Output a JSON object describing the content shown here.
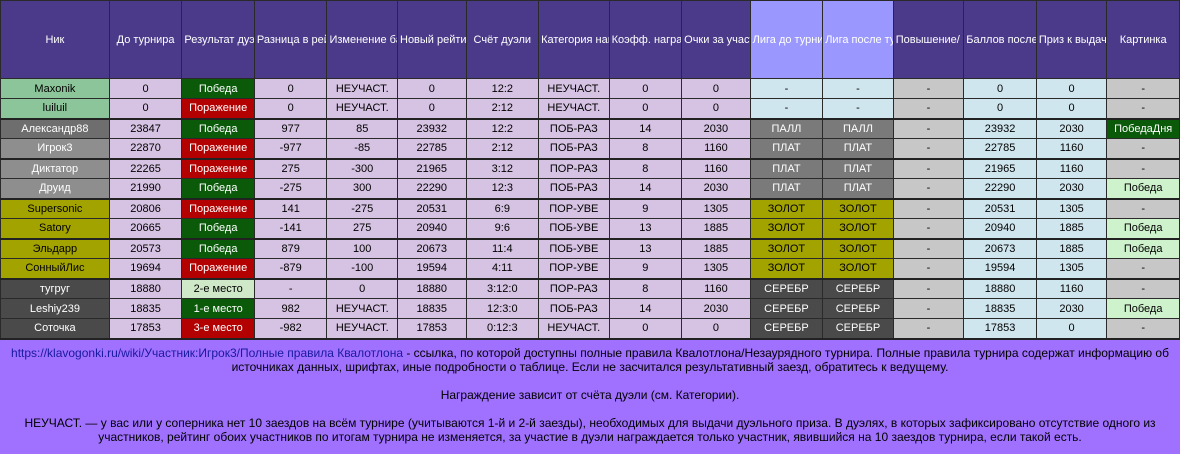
{
  "headers": [
    "Ник",
    "До турнира",
    "Результат дуэли",
    "Разница в рейтинге",
    "Изменение баллов",
    "Новый рейтинг",
    "Счёт дуэли",
    "Категория награждения",
    "Коэфф. награждения",
    "Очки за участие",
    "Лига до турнира",
    "Лига после турнира",
    "Повышение/ понижение",
    "Баллов после турнира",
    "Приз к выдаче, очков",
    "Картинка"
  ],
  "rows": [
    {
      "nick": "Maxonik",
      "nick_class": "nick-novice",
      "before": "0",
      "result": "Победа",
      "res_class": "c-win",
      "diff": "0",
      "change": "НЕУЧАСТ.",
      "new_rating": "0",
      "score": "12:2",
      "category": "НЕУЧАСТ.",
      "coef": "0",
      "points": "0",
      "league_before": "-",
      "league_after": "-",
      "lg_class": "lg-none",
      "promo": "-",
      "after_points": "0",
      "prize": "0",
      "picture": "-",
      "pic_class": "c-grey",
      "group_end": false
    },
    {
      "nick": "luiluil",
      "nick_class": "nick-novice",
      "before": "0",
      "result": "Поражение",
      "res_class": "c-lose",
      "diff": "0",
      "change": "НЕУЧАСТ.",
      "new_rating": "0",
      "score": "2:12",
      "category": "НЕУЧАСТ.",
      "coef": "0",
      "points": "0",
      "league_before": "-",
      "league_after": "-",
      "lg_class": "lg-none",
      "promo": "-",
      "after_points": "0",
      "prize": "0",
      "picture": "-",
      "pic_class": "c-grey",
      "group_end": true
    },
    {
      "nick": "Александр88",
      "nick_class": "nick-vet",
      "before": "23847",
      "result": "Победа",
      "res_class": "c-win",
      "diff": "977",
      "change": "85",
      "new_rating": "23932",
      "score": "12:2",
      "category": "ПОБ-РАЗ",
      "coef": "14",
      "points": "2030",
      "league_before": "ПАЛЛ",
      "league_after": "ПАЛЛ",
      "lg_class": "lg-pall",
      "promo": "-",
      "after_points": "23932",
      "prize": "2030",
      "picture": "ПобедаДня",
      "pic_class": "c-pic-day",
      "group_end": false
    },
    {
      "nick": "Игрок3",
      "nick_class": "nick-profi",
      "before": "22870",
      "result": "Поражение",
      "res_class": "c-lose",
      "diff": "-977",
      "change": "-85",
      "new_rating": "22785",
      "score": "2:12",
      "category": "ПОБ-РАЗ",
      "coef": "8",
      "points": "1160",
      "league_before": "ПЛАТ",
      "league_after": "ПЛАТ",
      "lg_class": "lg-plat",
      "promo": "-",
      "after_points": "22785",
      "prize": "1160",
      "picture": "-",
      "pic_class": "c-grey",
      "group_end": true
    },
    {
      "nick": "Диктатор",
      "nick_class": "nick-profi",
      "before": "22265",
      "result": "Поражение",
      "res_class": "c-lose",
      "diff": "275",
      "change": "-300",
      "new_rating": "21965",
      "score": "3:12",
      "category": "ПОР-РАЗ",
      "coef": "8",
      "points": "1160",
      "league_before": "ПЛАТ",
      "league_after": "ПЛАТ",
      "lg_class": "lg-plat",
      "promo": "-",
      "after_points": "21965",
      "prize": "1160",
      "picture": "-",
      "pic_class": "c-grey",
      "group_end": false
    },
    {
      "nick": "Друид",
      "nick_class": "nick-profi",
      "before": "21990",
      "result": "Победа",
      "res_class": "c-win",
      "diff": "-275",
      "change": "300",
      "new_rating": "22290",
      "score": "12:3",
      "category": "ПОБ-РАЗ",
      "coef": "14",
      "points": "2030",
      "league_before": "ПЛАТ",
      "league_after": "ПЛАТ",
      "lg_class": "lg-plat",
      "promo": "-",
      "after_points": "22290",
      "prize": "2030",
      "picture": "Победа",
      "pic_class": "c-pic-win",
      "group_end": true
    },
    {
      "nick": "Supersonic",
      "nick_class": "nick-gold",
      "before": "20806",
      "result": "Поражение",
      "res_class": "c-lose",
      "diff": "141",
      "change": "-275",
      "new_rating": "20531",
      "score": "6:9",
      "category": "ПОР-УВЕ",
      "coef": "9",
      "points": "1305",
      "league_before": "ЗОЛОТ",
      "league_after": "ЗОЛОТ",
      "lg_class": "lg-gold",
      "promo": "-",
      "after_points": "20531",
      "prize": "1305",
      "picture": "-",
      "pic_class": "c-grey",
      "group_end": false
    },
    {
      "nick": "Satory",
      "nick_class": "nick-gold",
      "before": "20665",
      "result": "Победа",
      "res_class": "c-win",
      "diff": "-141",
      "change": "275",
      "new_rating": "20940",
      "score": "9:6",
      "category": "ПОБ-УВЕ",
      "coef": "13",
      "points": "1885",
      "league_before": "ЗОЛОТ",
      "league_after": "ЗОЛОТ",
      "lg_class": "lg-gold",
      "promo": "-",
      "after_points": "20940",
      "prize": "1885",
      "picture": "Победа",
      "pic_class": "c-pic-win",
      "group_end": true
    },
    {
      "nick": "Эльдарр",
      "nick_class": "nick-gold",
      "before": "20573",
      "result": "Победа",
      "res_class": "c-win",
      "diff": "879",
      "change": "100",
      "new_rating": "20673",
      "score": "11:4",
      "category": "ПОБ-УВЕ",
      "coef": "13",
      "points": "1885",
      "league_before": "ЗОЛОТ",
      "league_after": "ЗОЛОТ",
      "lg_class": "lg-gold",
      "promo": "-",
      "after_points": "20673",
      "prize": "1885",
      "picture": "Победа",
      "pic_class": "c-pic-win",
      "group_end": false
    },
    {
      "nick": "СонныйЛис",
      "nick_class": "nick-gold",
      "before": "19694",
      "result": "Поражение",
      "res_class": "c-lose",
      "diff": "-879",
      "change": "-100",
      "new_rating": "19594",
      "score": "4:11",
      "category": "ПОР-УВЕ",
      "coef": "9",
      "points": "1305",
      "league_before": "ЗОЛОТ",
      "league_after": "ЗОЛОТ",
      "lg_class": "lg-gold",
      "promo": "-",
      "after_points": "19594",
      "prize": "1305",
      "picture": "-",
      "pic_class": "c-grey",
      "group_end": true
    },
    {
      "nick": "тугруг",
      "nick_class": "nick-silver",
      "before": "18880",
      "result": "2-е место",
      "res_class": "c-second",
      "diff": "-",
      "change": "0",
      "new_rating": "18880",
      "score": "3:12:0",
      "category": "ПОР-РАЗ",
      "coef": "8",
      "points": "1160",
      "league_before": "СЕРЕБР",
      "league_after": "СЕРЕБР",
      "lg_class": "lg-silver",
      "promo": "-",
      "after_points": "18880",
      "prize": "1160",
      "picture": "-",
      "pic_class": "c-grey",
      "group_end": false
    },
    {
      "nick": "Leshiy239",
      "nick_class": "nick-silver",
      "before": "18835",
      "result": "1-е место",
      "res_class": "c-win",
      "diff": "982",
      "change": "НЕУЧАСТ.",
      "new_rating": "18835",
      "score": "12:3:0",
      "category": "ПОБ-РАЗ",
      "coef": "14",
      "points": "2030",
      "league_before": "СЕРЕБР",
      "league_after": "СЕРЕБР",
      "lg_class": "lg-silver",
      "promo": "-",
      "after_points": "18835",
      "prize": "2030",
      "picture": "Победа",
      "pic_class": "c-pic-win",
      "group_end": false
    },
    {
      "nick": "Соточка",
      "nick_class": "nick-silver",
      "before": "17853",
      "result": "3-е место",
      "res_class": "c-lose",
      "diff": "-982",
      "change": "НЕУЧАСТ.",
      "new_rating": "17853",
      "score": "0:12:3",
      "category": "НЕУЧАСТ.",
      "coef": "0",
      "points": "0",
      "league_before": "СЕРЕБР",
      "league_after": "СЕРЕБР",
      "lg_class": "lg-silver",
      "promo": "-",
      "after_points": "17853",
      "prize": "0",
      "picture": "-",
      "pic_class": "c-grey",
      "group_end": true
    }
  ],
  "notes": {
    "link_text": "https://klavogonki.ru/wiki/Участник:Игрок3/Полные правила Квалотлона",
    "link_rest": " - ссылка, по которой доступны полные правила Квалотлона/Незаурядного турнира. Полные правила турнира содержат информацию об",
    "line2": "источниках данных, шрифтах, иные подробности о таблице. Если не засчитался результативный заезд, обратитесь к ведущему.",
    "line3": "Награждение зависит от счёта дуэли (см. Категории).",
    "line4": "НЕУЧАСТ. — у вас или у соперника нет 10 заездов на всём турнире (учитываются 1-й и 2-й заезды), необходимых для выдачи дуэльного приза. В дуэлях, в которых зафиксировано отсутствие одного из",
    "line5": "участников, рейтинг обоих участников по итогам турнира не изменяется, за участие в дуэли награждается только участник, явившийся на 10 заездов турнира, если такой есть."
  },
  "colors": {
    "header_dark": "#4b3a8a",
    "header_blue": "#9a98ff",
    "win": "#0a5a0a",
    "lose": "#b30000",
    "background": "#a070ff"
  }
}
